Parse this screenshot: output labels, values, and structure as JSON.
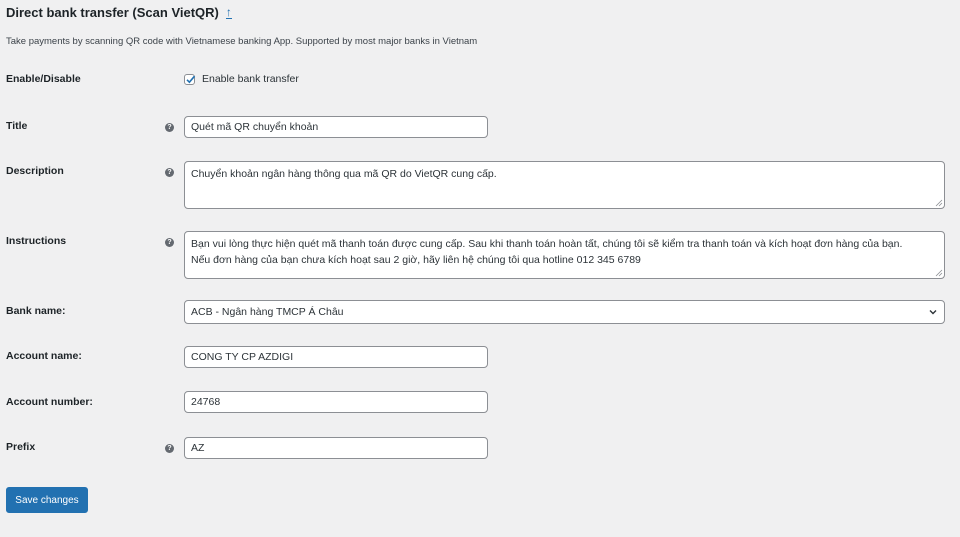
{
  "header": {
    "title": "Direct bank transfer (Scan VietQR)",
    "back_icon": "up-arrow-link-icon",
    "description": "Take payments by scanning QR code with Vietnamese banking App. Supported by most major banks in Vietnam"
  },
  "fields": {
    "enable": {
      "label": "Enable/Disable",
      "checkbox_label": "Enable bank transfer",
      "checked": true
    },
    "title": {
      "label": "Title",
      "value": "Quét mã QR chuyển khoản"
    },
    "description": {
      "label": "Description",
      "value": "Chuyển khoản ngân hàng thông qua mã QR do VietQR cung cấp."
    },
    "instructions": {
      "label": "Instructions",
      "line1": "Bạn vui lòng thực hiện quét mã thanh toán được cung cấp. Sau khi thanh toán hoàn tất, chúng tôi sẽ kiểm tra thanh toán và kích hoạt đơn hàng của bạn.",
      "line2": "Nếu đơn hàng của bạn chưa kích hoạt sau 2 giờ, hãy liên hệ chúng tôi qua hotline 012 345 6789"
    },
    "bank_name": {
      "label": "Bank name:",
      "value": "ACB - Ngân hàng TMCP Á Châu"
    },
    "account_name": {
      "label": "Account name:",
      "value": "CONG TY CP AZDIGI"
    },
    "account_number": {
      "label": "Account number:",
      "value": "24768"
    },
    "prefix": {
      "label": "Prefix",
      "value": "AZ"
    }
  },
  "actions": {
    "save_label": "Save changes"
  },
  "colors": {
    "accent": "#2271b1",
    "background": "#f0f0f1",
    "help_icon": "#646970"
  }
}
